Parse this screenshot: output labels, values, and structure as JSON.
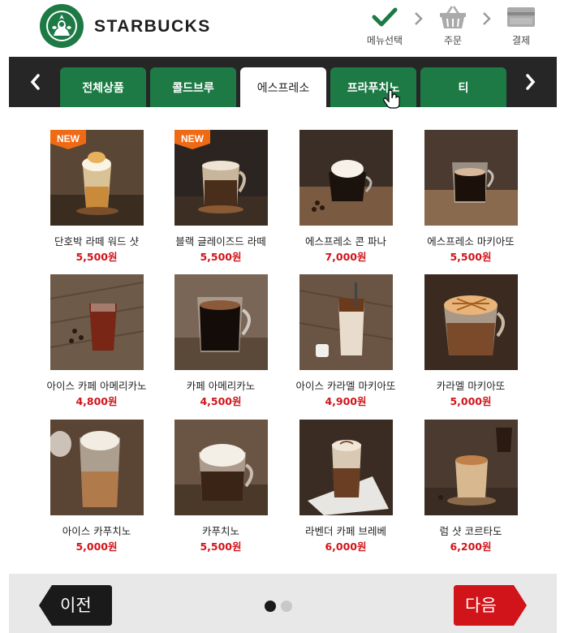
{
  "header": {
    "brand": "STARBUCKS",
    "steps": [
      {
        "label": "메뉴선택",
        "icon": "check-icon",
        "color": "#1d7a45"
      },
      {
        "label": "주문",
        "icon": "basket-icon"
      },
      {
        "label": "결제",
        "icon": "card-icon"
      }
    ]
  },
  "categories": {
    "tabs": [
      {
        "label": "전체상품"
      },
      {
        "label": "콜드브루"
      },
      {
        "label": "에스프레소",
        "active": true
      },
      {
        "label": "프라푸치노"
      },
      {
        "label": "티"
      }
    ]
  },
  "products": [
    {
      "name": "단호박 라떼 워드 샷",
      "price": "5,500원",
      "badge": "NEW"
    },
    {
      "name": "블랙 글레이즈드 라떼",
      "price": "5,500원",
      "badge": "NEW"
    },
    {
      "name": "에스프레소 콘 파나",
      "price": "7,000원"
    },
    {
      "name": "에스프레소 마키아또",
      "price": "5,500원"
    },
    {
      "name": "아이스 카페 아메리카노",
      "price": "4,800원"
    },
    {
      "name": "카페 아메리카노",
      "price": "4,500원"
    },
    {
      "name": "아이스 카라멜 마키아또",
      "price": "4,900원"
    },
    {
      "name": "카라멜 마키아또",
      "price": "5,000원"
    },
    {
      "name": "아이스 카푸치노",
      "price": "5,000원"
    },
    {
      "name": "카푸치노",
      "price": "5,500원"
    },
    {
      "name": "라벤더 카페 브레베",
      "price": "6,000원"
    },
    {
      "name": "럼 샷 코르타도",
      "price": "6,200원"
    }
  ],
  "footer": {
    "prev_label": "이전",
    "next_label": "다음",
    "pages": 2,
    "current_page": 1
  },
  "colors": {
    "brand_green": "#1d7a45",
    "price_red": "#d0141a",
    "badge_orange": "#ef6a14",
    "next_button": "#d0141a",
    "prev_button": "#1a1a1a"
  }
}
